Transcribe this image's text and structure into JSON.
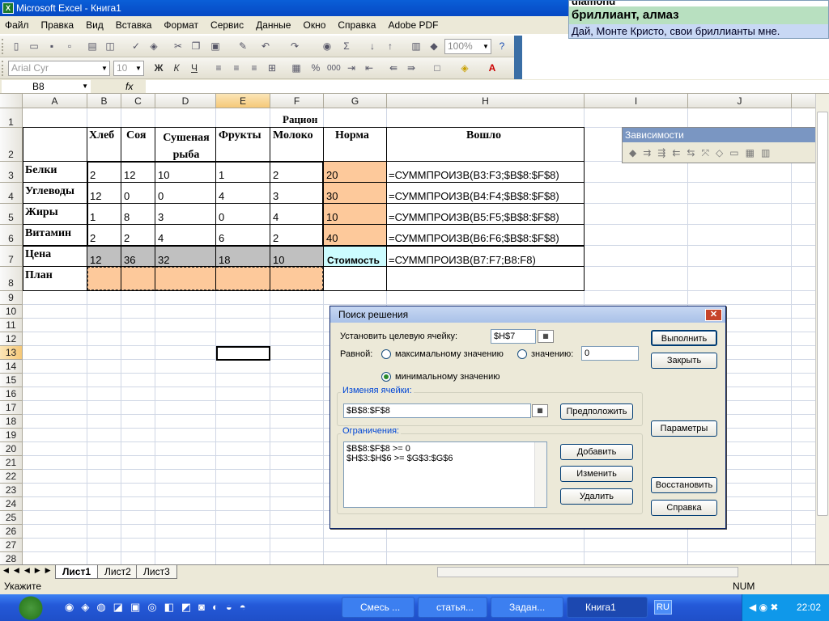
{
  "window": {
    "title": "Microsoft Excel - Книга1"
  },
  "popup": {
    "line1": "diamond",
    "line2": "бриллиант, алмаз",
    "line3": "Дай, Монте Кристо, свои бриллианты мне."
  },
  "menu": [
    "Файл",
    "Правка",
    "Вид",
    "Вставка",
    "Формат",
    "Сервис",
    "Данные",
    "Окно",
    "Справка",
    "Adobe PDF"
  ],
  "toolbar": {
    "zoom": "100%",
    "font": "Arial Cyr",
    "size": "10",
    "bold": "Ж",
    "italic": "К",
    "underline": "Ч",
    "percent": "%",
    "thousands": "000"
  },
  "formula_bar": {
    "name_box": "B8",
    "fx": "fx",
    "value": ""
  },
  "columns": [
    "A",
    "B",
    "C",
    "D",
    "E",
    "F",
    "G",
    "H",
    "I",
    "J"
  ],
  "rows": [
    "1",
    "2",
    "3",
    "4",
    "5",
    "6",
    "7",
    "8",
    "9",
    "10",
    "11",
    "12",
    "13",
    "14",
    "15",
    "16",
    "17",
    "18",
    "19",
    "20",
    "21",
    "22",
    "23",
    "24",
    "25",
    "26",
    "27",
    "28"
  ],
  "sheet": {
    "title": "Рацион",
    "headers": [
      "Хлеб",
      "Соя",
      "Сушеная рыба",
      "Фрукты",
      "Молоко",
      "Норма",
      "Вошло"
    ],
    "rows": [
      {
        "label": "Белки",
        "vals": [
          "2",
          "12",
          "10",
          "1",
          "2"
        ],
        "norm": "20",
        "formula": "=СУММПРОИЗВ(B3:F3;$B$8:$F$8)"
      },
      {
        "label": "Углеводы",
        "vals": [
          "12",
          "0",
          "0",
          "4",
          "3"
        ],
        "norm": "30",
        "formula": "=СУММПРОИЗВ(B4:F4;$B$8:$F$8)"
      },
      {
        "label": "Жиры",
        "vals": [
          "1",
          "8",
          "3",
          "0",
          "4"
        ],
        "norm": "10",
        "formula": "=СУММПРОИЗВ(B5:F5;$B$8:$F$8)"
      },
      {
        "label": "Витамин",
        "vals": [
          "2",
          "2",
          "4",
          "6",
          "2"
        ],
        "norm": "40",
        "formula": "=СУММПРОИЗВ(B6:F6;$B$8:$F$8)"
      }
    ],
    "price": {
      "label": "Цена",
      "vals": [
        "12",
        "36",
        "32",
        "18",
        "10"
      ],
      "cost_label": "Стоимость",
      "formula": "=СУММПРОИЗВ(B7:F7;B8:F8)"
    },
    "plan": {
      "label": "План"
    }
  },
  "deps_toolbar": {
    "title": "Зависимости"
  },
  "sheet_tabs": [
    "Лист1",
    "Лист2",
    "Лист3"
  ],
  "status": {
    "left": "Укажите",
    "num": "NUM"
  },
  "dialog": {
    "title": "Поиск решения",
    "target_label": "Установить целевую ячейку:",
    "target_value": "$H$7",
    "equal_label": "Равной:",
    "opt_max": "максимальному значению",
    "opt_value": "значению:",
    "value_field": "0",
    "opt_min": "минимальному значению",
    "changing_label": "Изменяя ячейки:",
    "changing_value": "$B$8:$F$8",
    "constraints_label": "Ограничения:",
    "constraints": [
      "$B$8:$F$8 >= 0",
      "$H$3:$H$6 >= $G$3:$G$6"
    ],
    "btn_solve": "Выполнить",
    "btn_close": "Закрыть",
    "btn_guess": "Предположить",
    "btn_options": "Параметры",
    "btn_add": "Добавить",
    "btn_change": "Изменить",
    "btn_delete": "Удалить",
    "btn_reset": "Восстановить",
    "btn_help": "Справка"
  },
  "taskbar": {
    "items": [
      "Смесь ...",
      "статья...",
      "Задан...",
      "Книга1"
    ],
    "lang": "RU",
    "clock": "22:02"
  }
}
